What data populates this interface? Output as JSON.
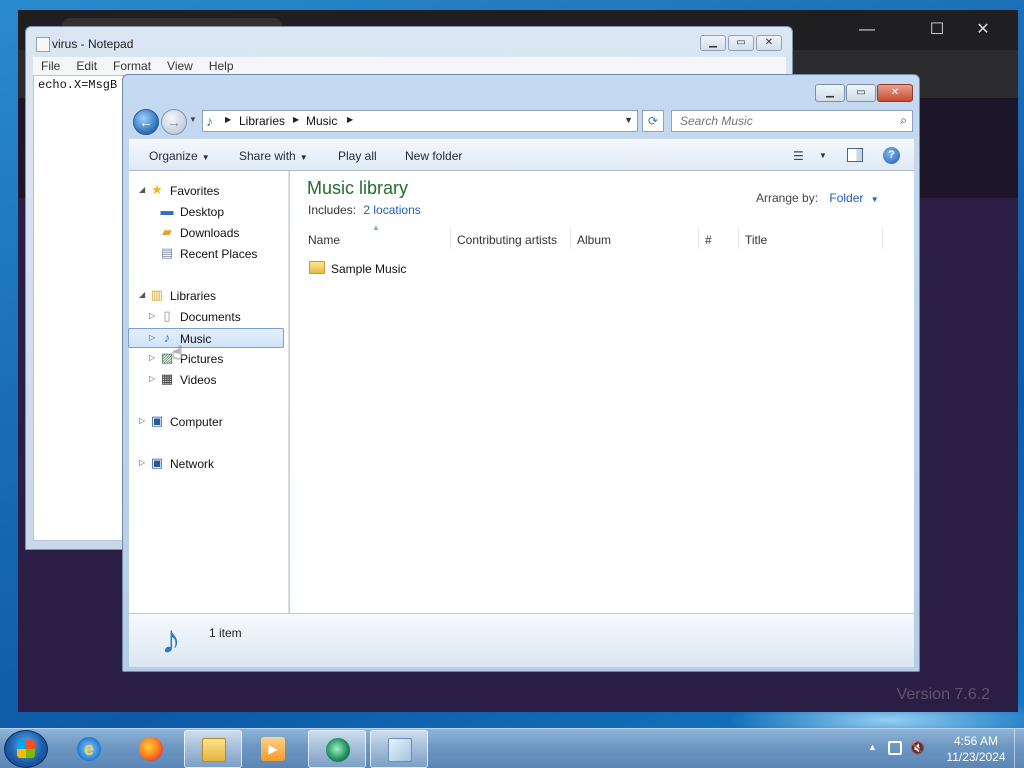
{
  "notepad": {
    "title": "virus - Notepad",
    "menu": [
      "File",
      "Edit",
      "Format",
      "View",
      "Help"
    ],
    "text": "echo.X=MsgB"
  },
  "browser": {
    "version_text": "Version 7.6.2"
  },
  "explorer": {
    "address": {
      "crumbs": [
        "Libraries",
        "Music"
      ]
    },
    "search": {
      "placeholder": "Search Music"
    },
    "toolbar": {
      "organize": "Organize",
      "share_with": "Share with",
      "play_all": "Play all",
      "new_folder": "New folder"
    },
    "navpane": {
      "favorites": "Favorites",
      "desktop": "Desktop",
      "downloads": "Downloads",
      "recent_places": "Recent Places",
      "libraries": "Libraries",
      "documents": "Documents",
      "music": "Music",
      "pictures": "Pictures",
      "videos": "Videos",
      "computer": "Computer",
      "network": "Network"
    },
    "library": {
      "title": "Music library",
      "includes_label": "Includes:",
      "includes_link": "2 locations",
      "arrange_label": "Arrange by:",
      "arrange_value": "Folder"
    },
    "columns": [
      "Name",
      "Contributing artists",
      "Album",
      "#",
      "Title"
    ],
    "items": [
      {
        "name": "Sample Music"
      }
    ],
    "status": {
      "count": "1 item"
    }
  },
  "taskbar": {
    "time": "4:56 AM",
    "date": "11/23/2024"
  },
  "colors": {
    "library_title": "#1e6e2e",
    "link": "#1e5fb8",
    "selection_border": "#7da2ce"
  },
  "icons": {
    "start": "windows-logo-icon",
    "apps": [
      "internet-explorer-icon",
      "firefox-icon",
      "windows-explorer-icon",
      "media-player-icon",
      "camtasia-icon",
      "notepad-icon"
    ]
  }
}
